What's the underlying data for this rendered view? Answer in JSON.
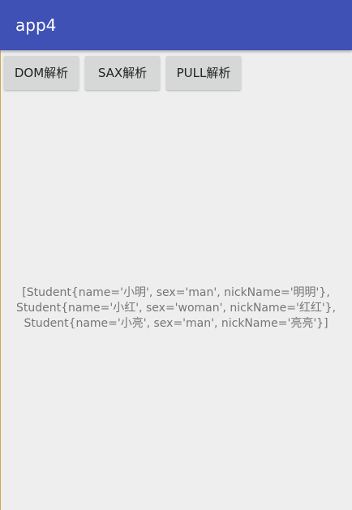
{
  "app_bar": {
    "title": "app4"
  },
  "buttons": {
    "dom_label": "DOM解析",
    "sax_label": "SAX解析",
    "pull_label": "PULL解析"
  },
  "result": {
    "lines": [
      "[Student{name='小明', sex='man', nickName='明明'},",
      "Student{name='小红', sex='woman', nickName='红红'},",
      "Student{name='小亮', sex='man', nickName='亮亮'}]"
    ]
  },
  "colors": {
    "app_bar": "#3f51b5",
    "background": "#eeeeee",
    "button": "#d6d7d7",
    "result_text": "#757575"
  }
}
